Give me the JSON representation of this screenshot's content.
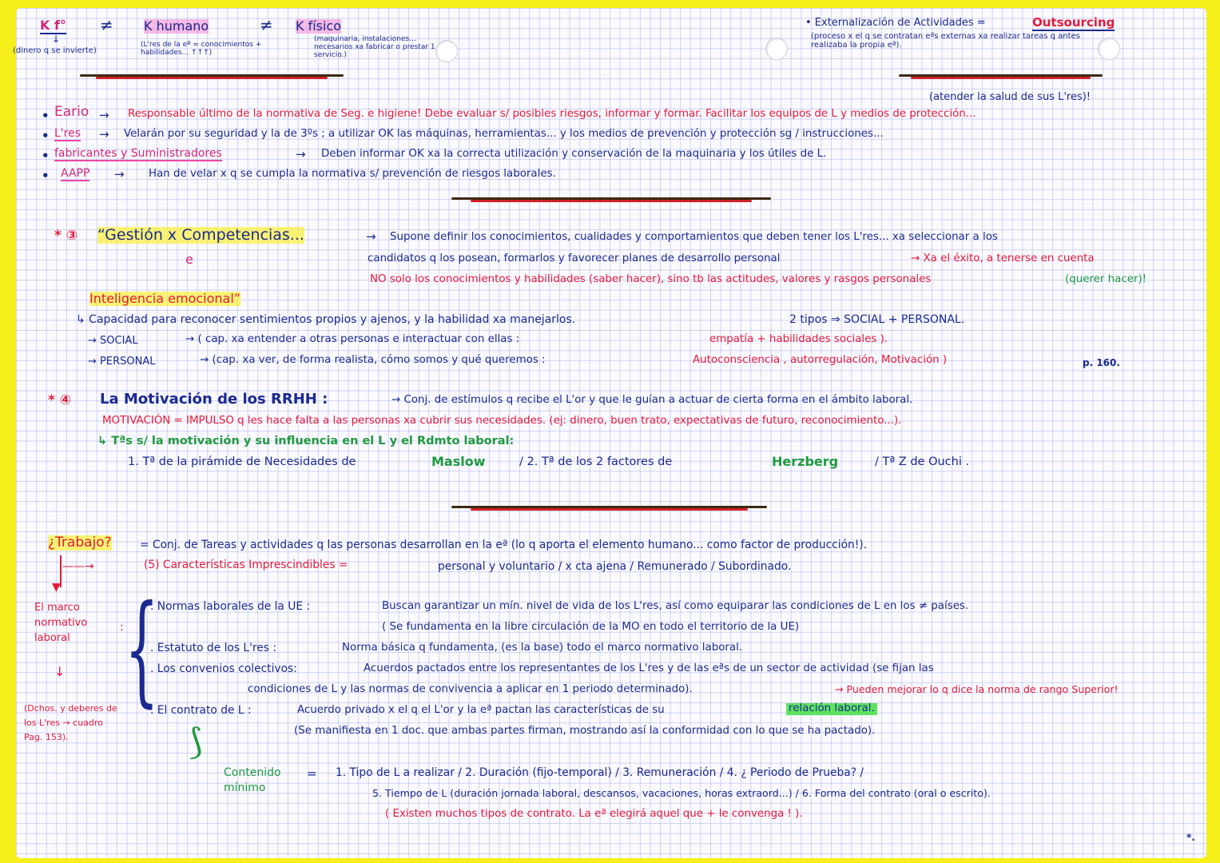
{
  "header": {
    "kf": "K f°",
    "neq1": "≠",
    "kf_note": "(dinero q se invierte)",
    "khumano": "K humano",
    "khumano_note": "(L'res de la eª = conocimientos + habilidades... ↑↑↑)",
    "neq2": "≠",
    "kfisico": "K físico",
    "kfisico_note": "(maquinaria, instalaciones... necesarios xa fabricar o prestar 1 servicio.)",
    "ext_title": "• Externalización de Actividades =",
    "outsourcing": "Outsourcing",
    "ext_note": "(proceso x el q se contratan eªs externas xa realizar tareas q antes realizaba la propia eª)."
  },
  "responsibilities": {
    "note": "(atender la salud de sus L'res)!",
    "items": [
      {
        "bullet": "•",
        "subject": "Eario",
        "arrow": "→",
        "text": "Responsable último de la normativa de Seg. e higiene! Debe evaluar s/ posibles riesgos, informar y formar. Facilitar los equipos de L y medios de protección..."
      },
      {
        "bullet": "•",
        "subject": "L'res",
        "arrow": "→",
        "text": "Velarán por su seguridad y la de 3ºs ; a utilizar OK las máquinas, herramientas... y los medios de prevención y protección sg / instrucciones..."
      },
      {
        "bullet": "•",
        "subject": "fabricantes y Suministradores",
        "arrow": "→",
        "text": "Deben informar OK xa la correcta utilización y conservación de la maquinaria y los útiles de L."
      },
      {
        "bullet": "•",
        "subject": "AAPP",
        "arrow": "→",
        "text": "Han de velar x q se cumpla la normativa s/ prevención de riesgos laborales."
      }
    ]
  },
  "section3": {
    "marker": "* ③",
    "title": "“Gestión x Competencias...",
    "title2": "e",
    "arrow": "→",
    "line1": "Supone definir los conocimientos, cualidades y comportamientos que deben tener los L'res... xa seleccionar a los",
    "line2": "candidatos q los posean, formarlos y favorecer planes de desarrollo personal",
    "line2_red": "→ Xa el éxito, a tenerse en cuenta",
    "line3": "NO solo los conocimientos y habilidades (saber hacer), sino tb las actitudes, valores y rasgos personales",
    "line3_green": "(querer hacer)!",
    "ie_title": "Inteligencia emocional”",
    "ie_line": "↳ Capacidad para reconocer sentimientos propios y ajenos, y la habilidad xa manejarlos.",
    "ie_types": "2 tipos ⇒ SOCIAL + PERSONAL.",
    "social_label": "→ SOCIAL",
    "social_text": "→ ( cap. xa entender a otras personas e interactuar con ellas :",
    "social_red": "empatía + habilidades sociales ).",
    "personal_label": "→ PERSONAL",
    "personal_text": "→ (cap. xa ver, de forma realista, cómo somos y qué queremos :",
    "personal_red": "Autoconsciencia , autorregulación, Motivación )",
    "page_ref": "p. 160."
  },
  "section4": {
    "marker": "* ④",
    "title": "La Motivación de los RRHH :",
    "title_text": "→ Conj. de estímulos q recibe el L'or y que le guían a actuar de cierta forma en el ámbito laboral.",
    "motivation_line": "MOTIVACIÓN = IMPULSO q les hace falta a las personas xa cubrir sus necesidades. (ej: dinero, buen trato, expectativas de futuro, reconocimiento...).",
    "theories_title": "↳ Tªs s/ la motivación y su influencia en el L y el Rdmto laboral:",
    "theory1": "1. Tª de la pirámide de Necesidades de",
    "theory1_name": "Maslow",
    "theory2": "/ 2. Tª de los 2 factores de",
    "theory2_name": "Herzberg",
    "theory3": "/ Tª Z de Ouchi ."
  },
  "trabajo": {
    "question": "¿Trabajo?",
    "def": "= Conj. de Tareas y actividades q las personas desarrollan en la eª (lo q aporta el elemento humano... como factor de producción!).",
    "char_label": "(5) Características Imprescindibles =",
    "char_text": "personal y voluntario / x cta ajena / Remunerado / Subordinado.",
    "marco": "El marco normativo laboral",
    "dchos": "(Dchos. y deberes de los L'res → cuadro Pag. 153).",
    "ue_label": ". Normas laborales de la UE :",
    "ue_text": "Buscan garantizar un mín. nivel de vida de los L'res, así como equiparar las condiciones de L en los ≠ países.",
    "ue_text2": "( Se fundamenta en la libre circulación de la MO en todo el territorio de la UE)",
    "estatuto_label": ". Estatuto de los L'res :",
    "estatuto_text": "Norma básica q fundamenta, (es la base) todo el marco normativo laboral.",
    "convenios_label": ". Los convenios colectivos:",
    "convenios_text": "Acuerdos pactados entre los representantes de los L'res y de las eªs de un sector de actividad (se fijan las",
    "convenios_text2": "condiciones de L y las normas de convivencia a aplicar en 1 periodo determinado).",
    "convenios_red": "→ Pueden mejorar lo q dice la norma de rango Superior!",
    "contrato_label": ". El contrato de L :",
    "contrato_text": "Acuerdo privado x el q el L'or y la eª pactan las características de su",
    "contrato_hl": "relación laboral.",
    "contrato_text2": "(Se manifiesta en 1 doc. que ambas partes firman, mostrando así la conformidad con lo que se ha pactado).",
    "contenido": "Contenido mínimo",
    "contenido_eq": "=",
    "min1": "1. Tipo de L a realizar / 2. Duración (fijo-temporal) / 3. Remuneración / 4. ¿ Periodo de Prueba? /",
    "min2": "5. Tiempo de L (duración jornada laboral, descansos, vacaciones, horas extraord...) / 6. Forma del contrato (oral o escrito).",
    "min3": "( Existen muchos tipos de contrato. La eª elegirá aquel que + le convenga ! ).",
    "corner": "*."
  }
}
